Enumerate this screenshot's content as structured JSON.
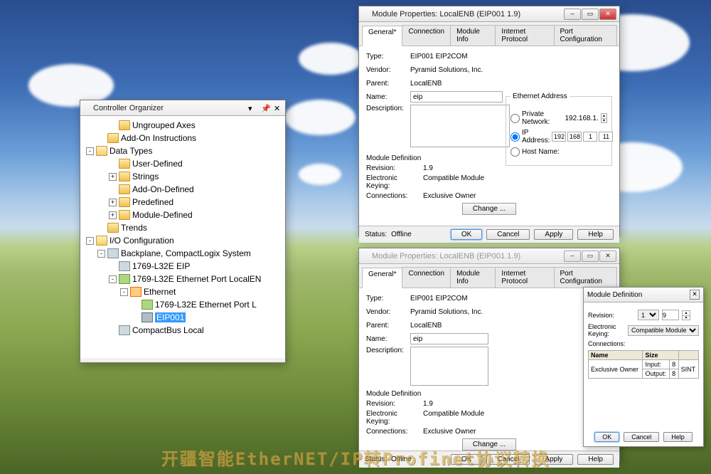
{
  "controllerOrganizer": {
    "title": "Controller Organizer",
    "tree": {
      "ungroupedAxes": "Ungrouped Axes",
      "addOnInstructions": "Add-On Instructions",
      "dataTypes": "Data Types",
      "userDefined": "User-Defined",
      "strings": "Strings",
      "addOnDefined": "Add-On-Defined",
      "predefined": "Predefined",
      "moduleDefined": "Module-Defined",
      "trends": "Trends",
      "ioConfig": "I/O Configuration",
      "backplane": "Backplane, CompactLogix System",
      "l32e_eip": "1769-L32E EIP",
      "l32e_port": "1769-L32E Ethernet Port LocalEN",
      "ethernet": "Ethernet",
      "l32e_port2": "1769-L32E Ethernet Port L",
      "eip001": "EIP001",
      "compactBus": "CompactBus Local"
    },
    "expanders": {
      "minus": "-",
      "plus": "+"
    }
  },
  "mp1": {
    "title": "Module Properties: LocalENB (EIP001 1.9)",
    "tabs": {
      "general": "General*",
      "connection": "Connection",
      "moduleInfo": "Module Info",
      "internetProtocol": "Internet Protocol",
      "portConfig": "Port Configuration"
    },
    "labels": {
      "type": "Type:",
      "vendor": "Vendor:",
      "parent": "Parent:",
      "name": "Name:",
      "description": "Description:"
    },
    "values": {
      "type": "EIP001 EIP2COM",
      "vendor": "Pyramid Solutions, Inc.",
      "parent": "LocalENB",
      "name": "eip"
    },
    "ethGroup": {
      "title": "Ethernet Address",
      "privateNetwork": "Private Network:",
      "privateVal": "192.168.1.",
      "ipAddress": "IP Address:",
      "ip": [
        "192",
        "168",
        "1",
        "11"
      ],
      "hostName": "Host Name:"
    },
    "modDef": {
      "title": "Module Definition",
      "revision": "Revision:",
      "revisionVal": "1.9",
      "ekeying": "Electronic Keying:",
      "ekeyingVal": "Compatible Module",
      "connections": "Connections:",
      "connectionsVal": "Exclusive Owner",
      "change": "Change ..."
    },
    "status": {
      "label": "Status:",
      "value": "Offline"
    },
    "buttons": {
      "ok": "OK",
      "cancel": "Cancel",
      "apply": "Apply",
      "help": "Help"
    }
  },
  "mp2": {
    "title": "Module Properties: LocalENB (EIP001 1.9)",
    "tabs": {
      "general": "General*",
      "connection": "Connection",
      "moduleInfo": "Module Info",
      "internetProtocol": "Internet Protocol",
      "portConfig": "Port Configuration"
    },
    "labels": {
      "type": "Type:",
      "vendor": "Vendor:",
      "parent": "Parent:",
      "name": "Name:",
      "description": "Description:"
    },
    "values": {
      "type": "EIP001 EIP2COM",
      "vendor": "Pyramid Solutions, Inc.",
      "parent": "LocalENB",
      "name": "eip"
    },
    "modDef": {
      "title": "Module Definition",
      "revision": "Revision:",
      "revisionVal": "1.9",
      "ekeying": "Electronic Keying:",
      "ekeyingVal": "Compatible Module",
      "connections": "Connections:",
      "connectionsVal": "Exclusive Owner",
      "change": "Change ..."
    },
    "status": {
      "label": "Status:",
      "value": "Offline"
    },
    "buttons": {
      "ok": "OK",
      "cancel": "Cancel",
      "apply": "Apply",
      "help": "Help"
    }
  },
  "mdlg": {
    "title": "Module Definition",
    "revision": "Revision:",
    "revMajor": "1",
    "revMinor": "9",
    "ekeying": "Electronic Keying:",
    "ekeyingVal": "Compatible Module",
    "connections": "Connections:",
    "table": {
      "name": "Name",
      "size": "Size",
      "rowName": "Exclusive Owner",
      "input": "Input:",
      "inputVal": "8",
      "output": "Output:",
      "outputVal": "8",
      "type": "SINT"
    },
    "buttons": {
      "ok": "OK",
      "cancel": "Cancel",
      "help": "Help"
    }
  },
  "watermark": "开疆智能EtherNET/IP转Profinet协议转换"
}
